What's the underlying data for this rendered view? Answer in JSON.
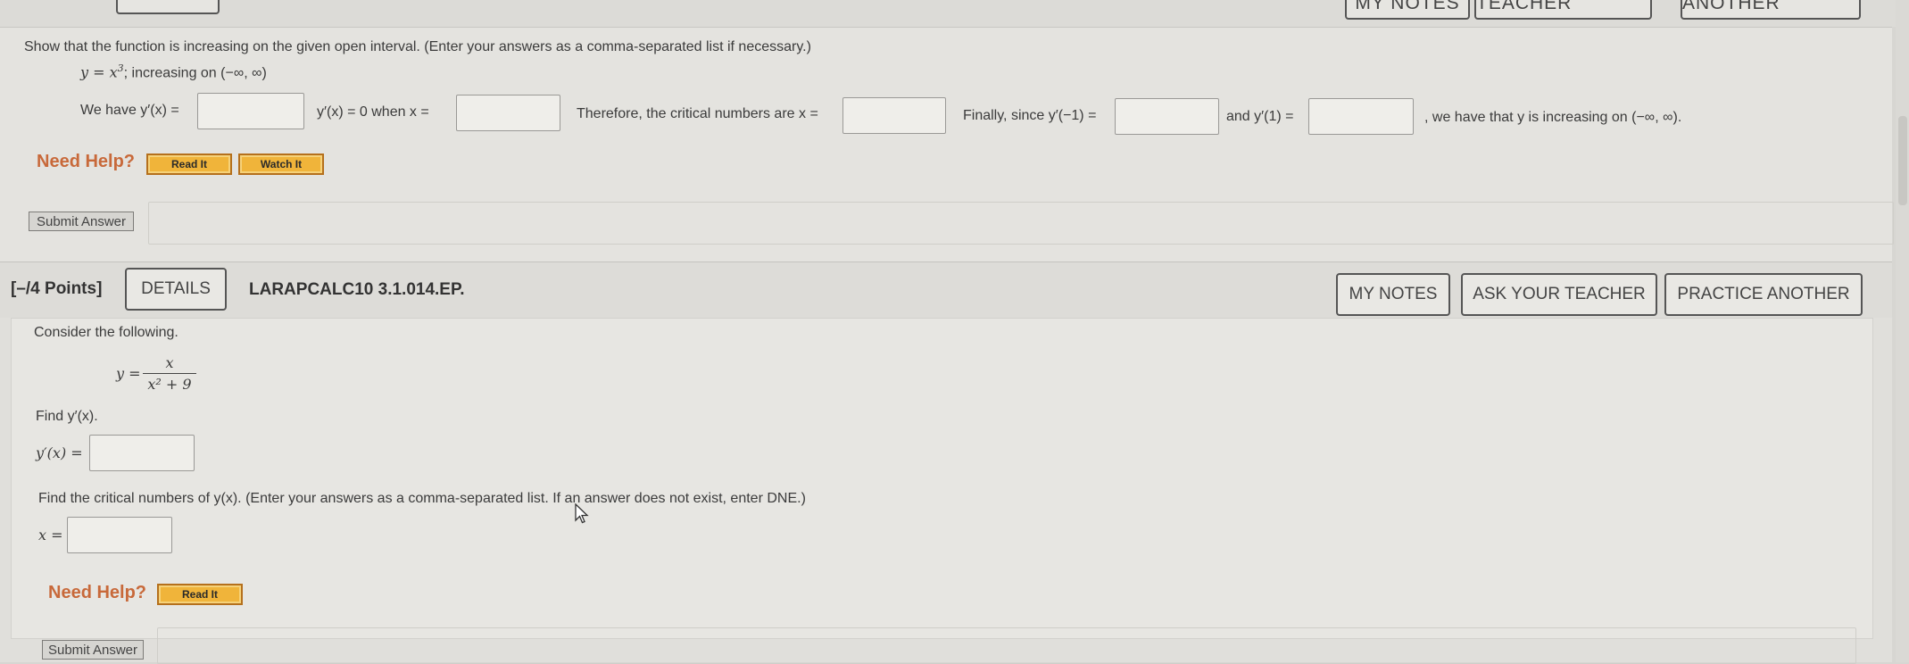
{
  "top": {
    "my_notes": "MY NOTES",
    "ask_teacher": "ASK YOUR TEACHER",
    "practice_another": "PRACTICE ANOTHER"
  },
  "q1": {
    "instruction": "Show that the function is increasing on the given open interval. (Enter your answers as a comma-separated list if necessary.)",
    "function_lhs": "y = x",
    "function_exp": "3",
    "function_rest": "; increasing on (−∞, ∞)",
    "we_have": "We have y′(x) =",
    "yprime_zero_when": "y′(x) = 0 when x =",
    "therefore": "Therefore, the critical numbers are x =",
    "finally": "Finally, since y′(−1) =",
    "and_y1": "and y′(1) =",
    "conclusion": ", we have that y is increasing on (−∞, ∞).",
    "need_help": "Need Help?",
    "read_it": "Read It",
    "watch_it": "Watch It",
    "submit": "Submit Answer"
  },
  "q2": {
    "points": "[–/4 Points]",
    "details": "DETAILS",
    "code": "LARAPCALC10 3.1.014.EP.",
    "my_notes": "MY NOTES",
    "ask_teacher": "ASK YOUR TEACHER",
    "practice_another": "PRACTICE ANOTHER",
    "consider": "Consider the following.",
    "y_eq": "y =",
    "numerator": "x",
    "denominator": "x² + 9",
    "find_yprime": "Find y′(x).",
    "yprime_label": "y′(x) =",
    "find_critical": "Find the critical numbers of y(x). (Enter your answers as a comma-separated list. If an answer does not exist, enter DNE.)",
    "x_label": "x =",
    "need_help": "Need Help?",
    "read_it": "Read It",
    "submit": "Submit Answer"
  }
}
